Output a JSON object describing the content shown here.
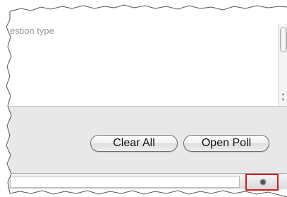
{
  "question_area": {
    "hint": "estion type"
  },
  "scrollbar": {
    "up_arrow": "▲",
    "down_arrow": "▼"
  },
  "buttons": {
    "clear_all": "Clear All",
    "open_poll": "Open Poll"
  },
  "status_bar": {
    "settings_icon": "gear-icon",
    "settings_glyph": "✹",
    "highlight_color": "#cc1f1f"
  }
}
